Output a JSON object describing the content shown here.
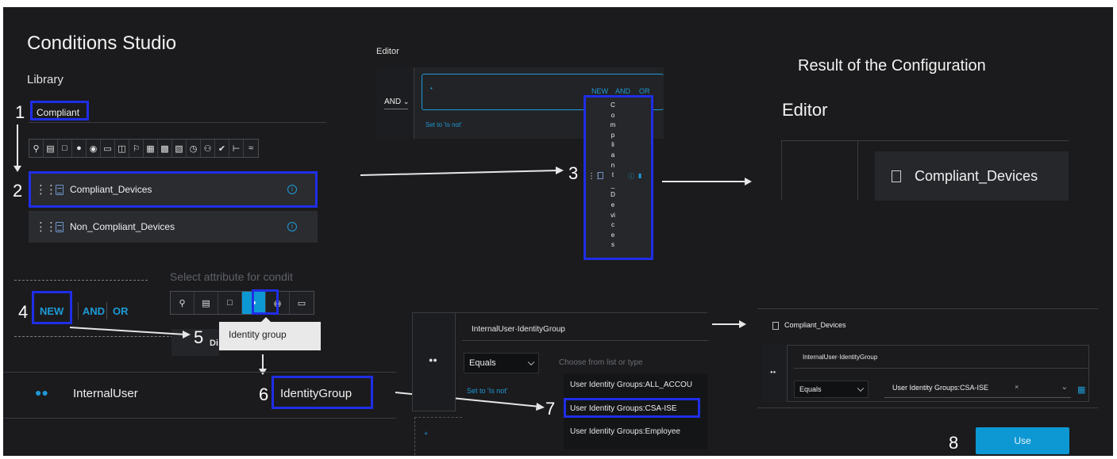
{
  "library": {
    "title": "Conditions Studio",
    "subtitle": "Library",
    "search_value": "Compliant",
    "items": [
      {
        "label": "Compliant_Devices"
      },
      {
        "label": "Non_Compliant_Devices"
      }
    ],
    "icon_names": [
      "location-icon",
      "card-icon",
      "square-icon",
      "group-icon",
      "circle-icon",
      "monitor-icon",
      "display-icon",
      "flag-icon",
      "browser-icon",
      "document-icon",
      "building-icon",
      "clock-icon",
      "user-icon",
      "check-icon",
      "hierarchy-icon",
      "wifi-icon"
    ]
  },
  "attribute_panel": {
    "placeholder": "Select attribute for condit",
    "new_label": "NEW",
    "and_label": "AND",
    "or_label": "OR",
    "tooltip": "Identity group",
    "partial_text": "Di",
    "internal_user": "InternalUser",
    "identity_group": "IdentityGroup"
  },
  "editor_top": {
    "title": "Editor",
    "operator": "AND",
    "new_label": "NEW",
    "and_label": "AND",
    "or_label": "OR",
    "set_to": "Set to 'Is not'",
    "vertical_letters": [
      "C",
      "o",
      "m",
      "p",
      "li",
      "a",
      "n",
      "t",
      "_",
      "D",
      "e",
      "vi",
      "c",
      "e",
      "s"
    ]
  },
  "result": {
    "heading": "Result of the Configuration",
    "editor_label": "Editor",
    "condition": "Compliant_Devices"
  },
  "editor_bottom": {
    "attribute": "InternalUser·IdentityGroup",
    "operator": "Equals",
    "placeholder": "Choose from list or type",
    "set_to": "Set to 'Is not'",
    "options": [
      "User Identity Groups:ALL_ACCOU",
      "User Identity Groups:CSA-ISE",
      "User Identity Groups:Employee"
    ]
  },
  "final": {
    "condition": "Compliant_Devices",
    "attribute": "InternalUser·IdentityGroup",
    "operator": "Equals",
    "value": "User Identity Groups:CSA-ISE",
    "remove": "×",
    "use_button": "Use"
  },
  "steps": [
    "1",
    "2",
    "3",
    "4",
    "5",
    "6",
    "7",
    "8"
  ],
  "colors": {
    "highlight": "#1f2ee6",
    "accent": "#1e9ad6",
    "use_button": "#0d98d3"
  }
}
